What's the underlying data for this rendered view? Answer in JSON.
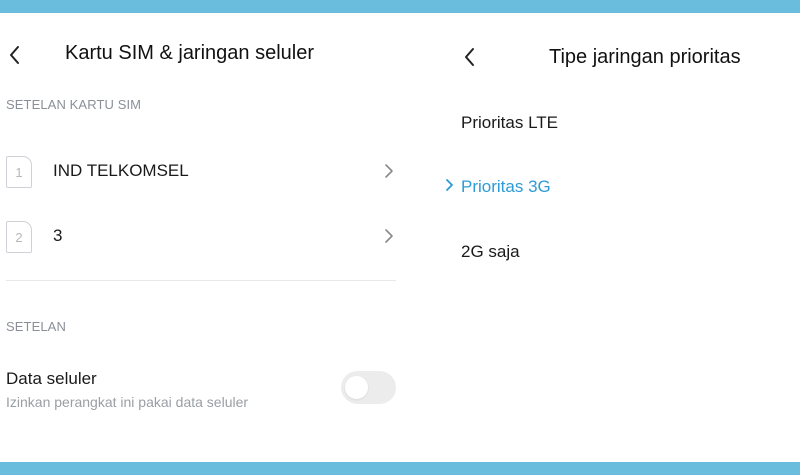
{
  "left": {
    "title": "Kartu SIM & jaringan seluler",
    "sim_section_header": "SETELAN KARTU SIM",
    "sims": [
      {
        "slot": "1",
        "name": "IND TELKOMSEL"
      },
      {
        "slot": "2",
        "name": "3"
      }
    ],
    "settings_section_header": "SETELAN",
    "mobile_data": {
      "title": "Data seluler",
      "subtitle": "Izinkan perangkat ini pakai data seluler",
      "enabled": false
    }
  },
  "right": {
    "title": "Tipe jaringan prioritas",
    "options": [
      {
        "label": "Prioritas LTE",
        "selected": false
      },
      {
        "label": "Prioritas 3G",
        "selected": true
      },
      {
        "label": "2G saja",
        "selected": false
      }
    ]
  },
  "colors": {
    "accent": "#2e9bd6",
    "frame_border": "#6bbddd",
    "section_header": "#8a8f99"
  },
  "icons": {
    "back": "chevron-left-icon",
    "row_arrow": "chevron-right-icon",
    "selected_marker": "chevron-right-icon"
  }
}
